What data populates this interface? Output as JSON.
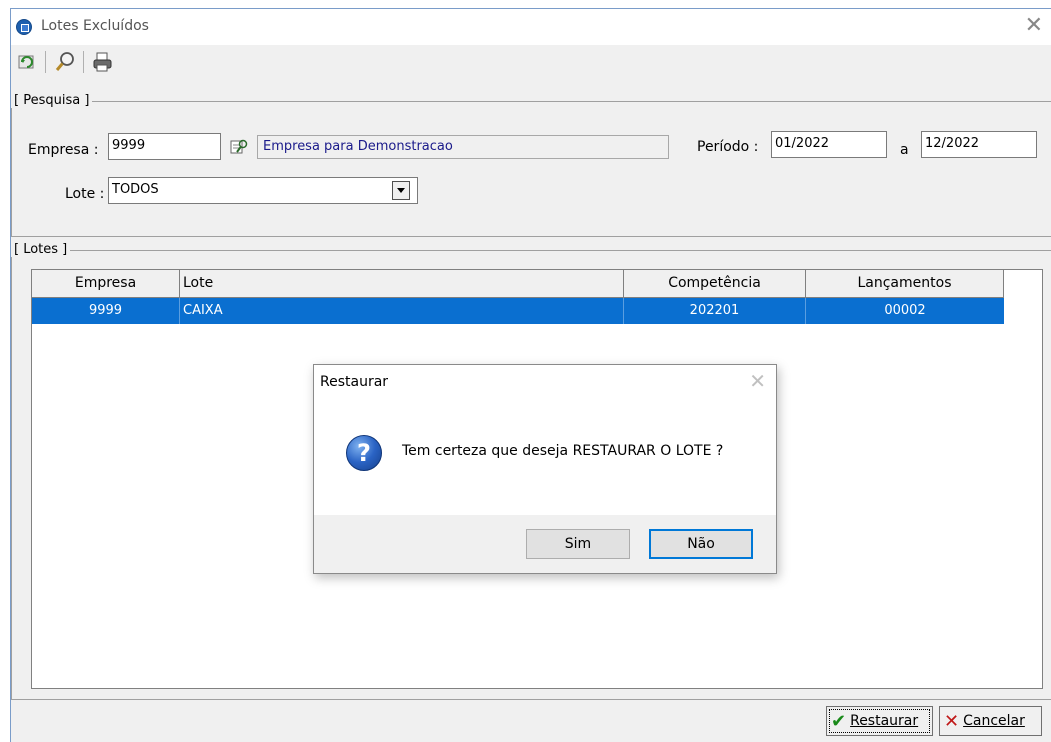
{
  "window": {
    "title": "Lotes Excluídos"
  },
  "toolbar": {
    "icons": [
      "refresh-icon",
      "search-icon",
      "print-icon"
    ]
  },
  "pesquisa": {
    "label": "[ Pesquisa ]",
    "empresa_label": "Empresa :",
    "empresa_value": "9999",
    "empresa_name": "Empresa para Demonstracao",
    "periodo_label": "Período :",
    "periodo_from": "01/2022",
    "periodo_sep": "a",
    "periodo_to": "12/2022",
    "lote_label": "Lote :",
    "lote_value": "TODOS"
  },
  "lotes": {
    "label": "[ Lotes ]",
    "columns": [
      "Empresa",
      "Lote",
      "Competência",
      "Lançamentos"
    ],
    "rows": [
      {
        "empresa": "9999",
        "lote": "CAIXA",
        "competencia": "202201",
        "lancamentos": "00002"
      }
    ]
  },
  "dialog": {
    "title": "Restaurar",
    "message": "Tem certeza que deseja RESTAURAR O LOTE ?",
    "yes_label": "Sim",
    "no_label": "Não"
  },
  "actions": {
    "restore_label": "Restaurar",
    "cancel_label": "Cancelar"
  },
  "colors": {
    "selection": "#0a6fd0",
    "accent": "#0078d7"
  }
}
